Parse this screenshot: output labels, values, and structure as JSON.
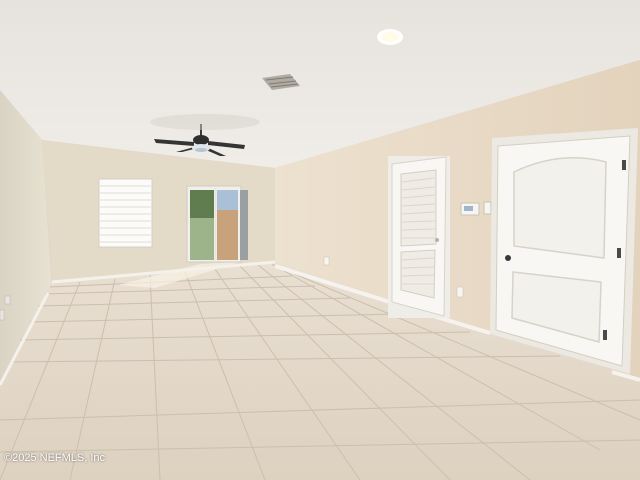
{
  "photo": {
    "watermark": "©2025 NEFMLS, Inc"
  },
  "colors": {
    "ceiling": "#ece9e3",
    "back_wall": "#e4dac8",
    "right_wall": "#eadcc8",
    "left_wall": "#e3ddcd",
    "floor_tile": "#e2d7c8",
    "grout": "#c9bcab",
    "door": "#f7f5f1",
    "baseboard": "#f4f1ea"
  }
}
